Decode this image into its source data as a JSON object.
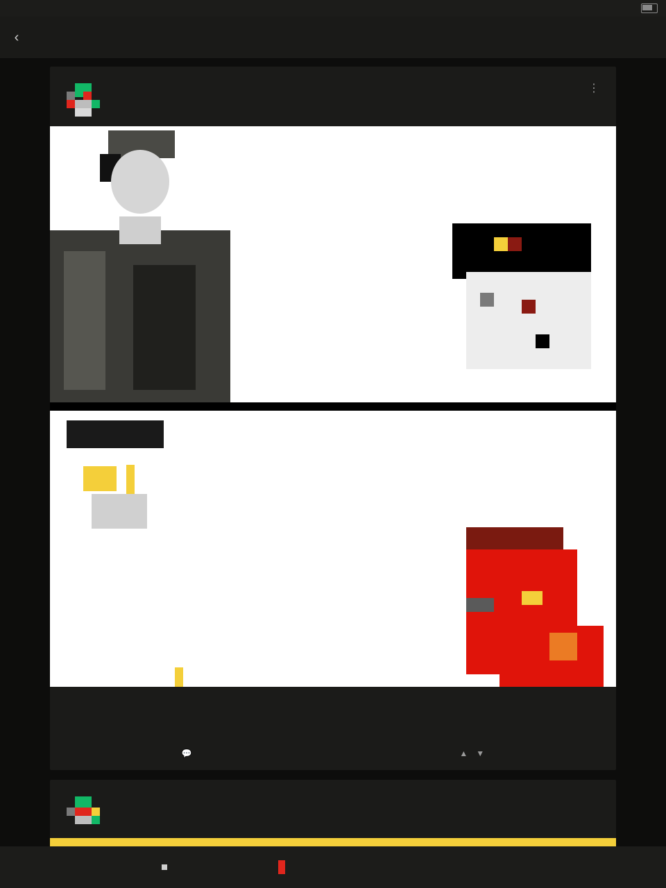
{
  "status_bar": {
    "carrier": "",
    "time": ""
  },
  "topbar": {
    "title_left": "",
    "title_mid": "",
    "title_right": ""
  },
  "post1": {
    "author": "",
    "flair": "",
    "meta": "",
    "captions": {
      "t1": "",
      "t2": "",
      "t3": "",
      "t4": "",
      "t5": ""
    },
    "title": "",
    "subtitle": "",
    "subtitle_hl": "",
    "comments_label": "",
    "votes": ""
  },
  "post2": {
    "author": "",
    "meta": ""
  },
  "bottom_nav": {
    "items": [
      "",
      "",
      "",
      "",
      "",
      ""
    ]
  },
  "colors": {
    "background": "#0d0d0c",
    "card": "#1b1b19",
    "accent_yellow": "#f4d23b",
    "accent_red": "#e0261d",
    "avatar_green": "#12b866"
  }
}
